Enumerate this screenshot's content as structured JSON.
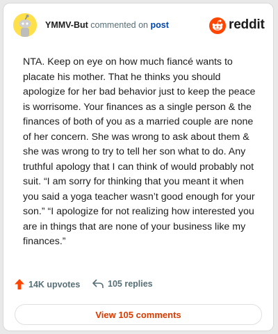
{
  "comment": {
    "username": "YMMV-But",
    "action_text": "commented on",
    "target_link": "post",
    "body": "NTA. Keep on eye on how much fiancé wants to placate his mother. That he thinks you should apologize for her bad behavior just to keep the peace is worrisome. Your finances as a single person & the finances of both of you as a married couple are none of her concern. She was wrong to ask about them & she was wrong to try to tell her son what to do. Any truthful apology that I can think of would probably not suit. “I am sorry for thinking that you meant it when you said a yoga teacher wasn’t good enough for your son.” “I apologize for not realizing how interested you are in things that are none of your business like my finances.”"
  },
  "brand": {
    "name": "reddit",
    "icon": "reddit-logo-icon",
    "color": "#ff4500"
  },
  "stats": {
    "upvotes": "14K upvotes",
    "upvote_icon": "upvote-arrow-icon",
    "upvote_color": "#ff4500",
    "replies": "105 replies",
    "reply_icon": "reply-arrow-icon"
  },
  "view_comments_label": "View 105 comments",
  "accent_color": "#d93a00"
}
